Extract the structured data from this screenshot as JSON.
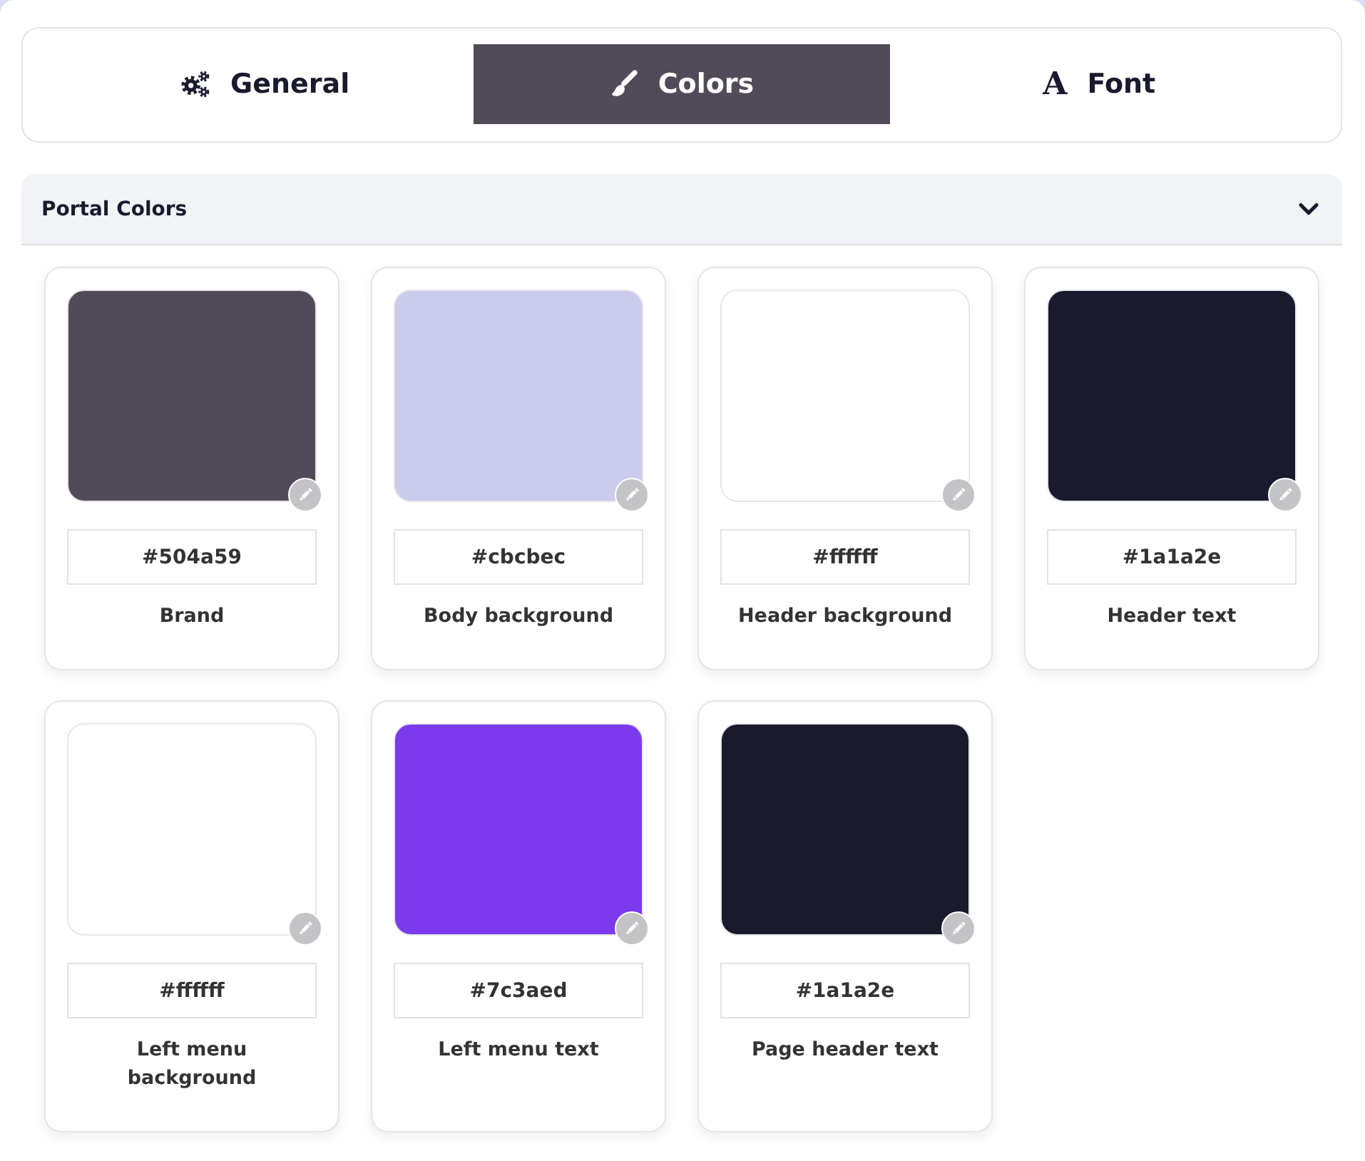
{
  "tabs": [
    {
      "label": "General",
      "selected": false
    },
    {
      "label": "Colors",
      "selected": true
    },
    {
      "label": "Font",
      "glyph": "A",
      "selected": false
    }
  ],
  "section": {
    "title": "Portal Colors",
    "expanded": true,
    "swatches": [
      {
        "label": "Brand",
        "value": "#504a59",
        "color": "#504a59"
      },
      {
        "label": "Body background",
        "value": "#cbcbec",
        "color": "#cbcbec"
      },
      {
        "label": "Header background",
        "value": "#ffffff",
        "color": "#ffffff"
      },
      {
        "label": "Header text",
        "value": "#1a1a2e",
        "color": "#1a1a2e"
      },
      {
        "label": "Left menu background",
        "value": "#ffffff",
        "color": "#ffffff"
      },
      {
        "label": "Left menu text",
        "value": "#7c3aed",
        "color": "#7c3aed"
      },
      {
        "label": "Page header text",
        "value": "#1a1a2e",
        "color": "#1a1a2e"
      }
    ]
  }
}
